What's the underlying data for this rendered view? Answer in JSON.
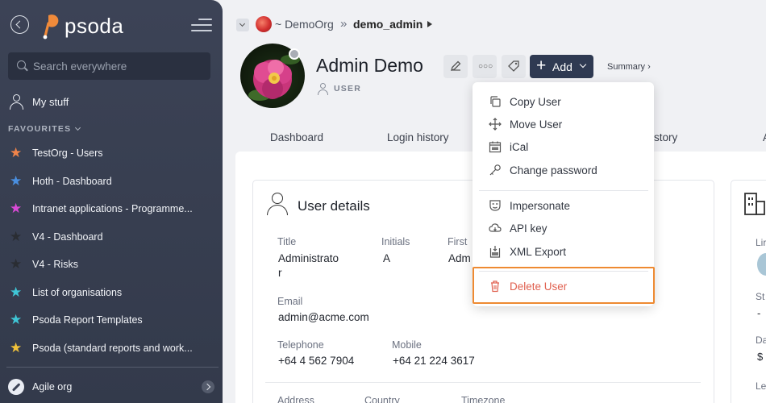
{
  "sidebar": {
    "logo_text": "psoda",
    "search_placeholder": "Search everywhere",
    "my_stuff": "My stuff",
    "favourites_heading": "FAVOURITES",
    "favourites": [
      {
        "label": "TestOrg - Users",
        "star_color": "#f0844a"
      },
      {
        "label": "Hoth - Dashboard",
        "star_color": "#4a8fe0"
      },
      {
        "label": "Intranet applications - Programme...",
        "star_color": "#d94ad6"
      },
      {
        "label": "V4 - Dashboard",
        "star_color": "#2a2d33"
      },
      {
        "label": "V4 - Risks",
        "star_color": "#2a2d33"
      },
      {
        "label": "List of organisations",
        "star_color": "#3fc6d6"
      },
      {
        "label": "Psoda Report Templates",
        "star_color": "#3fc6d6"
      },
      {
        "label": "Psoda (standard reports and work...",
        "star_color": "#f2c33a"
      }
    ],
    "current_org": "Agile org"
  },
  "breadcrumb": {
    "org": "~ DemoOrg",
    "separator": "»",
    "user": "demo_admin"
  },
  "header": {
    "title": "Admin Demo",
    "role": "USER",
    "add_label": "Add",
    "summary_label": "Summary ›"
  },
  "tabs": [
    {
      "label": "Dashboard"
    },
    {
      "label": "Login history"
    },
    {
      "label": "istory"
    },
    {
      "label": "A"
    }
  ],
  "user_details": {
    "heading": "User details",
    "fields": {
      "title_label": "Title",
      "title_value_1": "Administrato",
      "title_value_2": "r",
      "initials_label": "Initials",
      "initials_value": "A",
      "first_label": "First",
      "first_value": "Adm",
      "email_label": "Email",
      "email_value": "admin@acme.com",
      "telephone_label": "Telephone",
      "telephone_value": "+64 4 562 7904",
      "mobile_label": "Mobile",
      "mobile_value": "+64 21 224 3617",
      "address_label": "Address",
      "country_label": "Country",
      "timezone_label": "Timezone"
    }
  },
  "side_card": {
    "labels": [
      "Lir",
      "St",
      "Da",
      "Le"
    ],
    "values": [
      "-",
      "$"
    ]
  },
  "menu": {
    "items": [
      {
        "label": "Copy User",
        "icon": "copy-icon"
      },
      {
        "label": "Move User",
        "icon": "move-icon"
      },
      {
        "label": "iCal",
        "icon": "ical-icon"
      },
      {
        "label": "Change password",
        "icon": "key-icon"
      },
      {
        "label": "Impersonate",
        "icon": "mask-icon"
      },
      {
        "label": "API key",
        "icon": "cloud-icon"
      },
      {
        "label": "XML Export",
        "icon": "xml-icon"
      },
      {
        "label": "Delete User",
        "icon": "trash-icon"
      }
    ],
    "danger_color": "#e0604f",
    "highlight_color": "#ee8a32"
  }
}
